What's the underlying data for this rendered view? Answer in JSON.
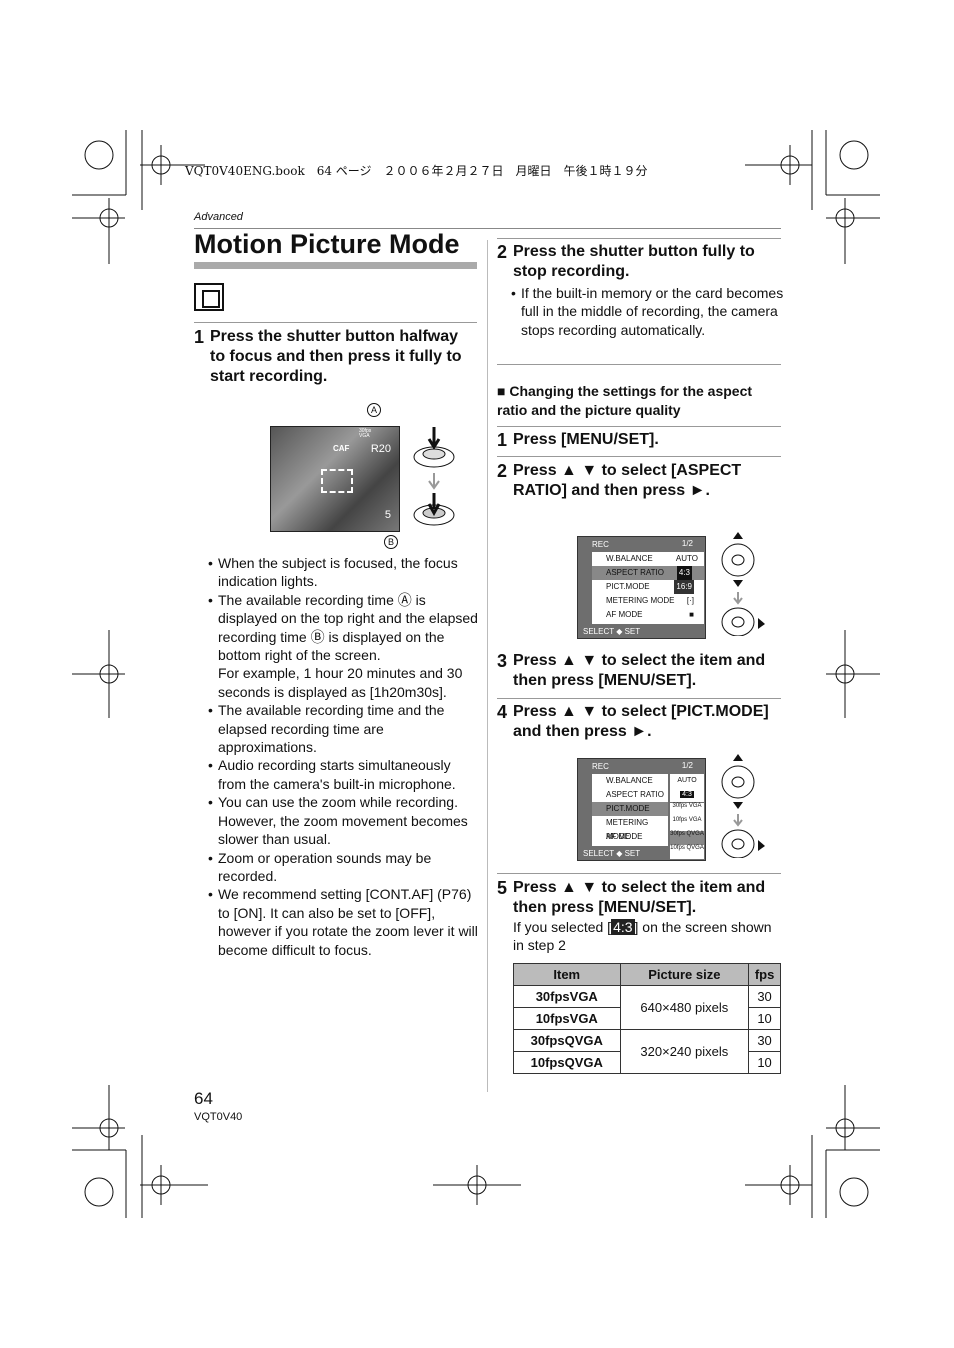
{
  "header": {
    "print_line": "VQT0V40ENG.book　64 ページ　２００６年２月２７日　月曜日　午後１時１９分"
  },
  "section": "Advanced",
  "title": "Motion Picture Mode",
  "left": {
    "step1": {
      "num": "1",
      "text": "Press the shutter button halfway to focus and then press it fully to start recording."
    },
    "screen": {
      "label_a": "A",
      "label_b": "B",
      "remaining": "R20",
      "elapsed": "5",
      "mode": "30fps VGA",
      "af": "CAF"
    },
    "bullets": [
      "When the subject is focused, the focus indication lights.",
      "The available recording time Ⓐ is displayed on the top right and the elapsed recording time Ⓑ is displayed on the bottom right of the screen.\nFor example, 1 hour 20 minutes and 30 seconds is displayed as [1h20m30s].",
      "The available recording time and the elapsed recording time are approximations.",
      "Audio recording starts simultaneously from the camera's built-in microphone.",
      "You can use the zoom while recording. However, the zoom movement becomes slower than usual.",
      "Zoom or operation sounds may be recorded.",
      "We recommend setting [CONT.AF] (P76) to [ON]. It can also be set to [OFF], however if you rotate the zoom lever it will become difficult to focus."
    ]
  },
  "right": {
    "step2": {
      "num": "2",
      "text": "Press the shutter button fully to stop recording.",
      "bullet": "If the built-in memory or the card becomes full in the middle of recording, the camera stops recording automatically."
    },
    "subhead": "■ Changing the settings for the aspect ratio and the picture quality",
    "s1": {
      "num": "1",
      "text": "Press [MENU/SET]."
    },
    "s2": {
      "num": "2",
      "text": "Press ▲ ▼ to select [ASPECT RATIO] and then press ►."
    },
    "s3": {
      "num": "3",
      "text": "Press ▲ ▼ to select the item and then press [MENU/SET]."
    },
    "s4": {
      "num": "4",
      "text": "Press ▲ ▼ to select [PICT.MODE] and then press ►."
    },
    "s5": {
      "num": "5",
      "text": "Press ▲ ▼ to select the item and then press [MENU/SET].",
      "note_pre": "If you selected [",
      "note_icon": "4:3",
      "note_post": "] on the screen shown in step 2"
    },
    "menu1": {
      "title": "REC",
      "page": "1/2",
      "items": [
        "W.BALANCE",
        "ASPECT RATIO",
        "PICT.MODE",
        "METERING MODE",
        "AF MODE"
      ],
      "values": [
        "AUTO",
        "4:3",
        "16:9",
        "[·]",
        "■"
      ],
      "footer": "SELECT ◆ SET"
    },
    "menu2": {
      "title": "REC",
      "page": "1/2",
      "items": [
        "W.BALANCE",
        "ASPECT RATIO",
        "PICT.MODE",
        "METERING MODE",
        "AF MODE"
      ],
      "values": [
        "AUTO",
        "4:3",
        "30fps VGA",
        "10fps VGA",
        "30fps QVGA",
        "10fps QVGA"
      ],
      "footer": "SELECT ◆ SET"
    },
    "table": {
      "headers": [
        "Item",
        "Picture size",
        "fps"
      ],
      "rows": [
        [
          "30fpsVGA",
          "640×480 pixels",
          "30"
        ],
        [
          "10fpsVGA",
          "",
          "10"
        ],
        [
          "30fpsQVGA",
          "320×240 pixels",
          "30"
        ],
        [
          "10fpsQVGA",
          "",
          "10"
        ]
      ]
    }
  },
  "footer": {
    "page": "64",
    "model": "VQT0V40"
  }
}
